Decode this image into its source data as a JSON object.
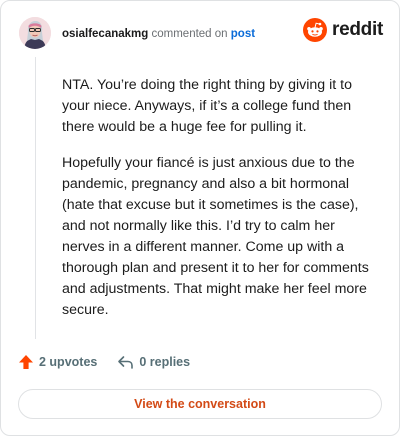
{
  "comment": {
    "author": "osialfecanakmg",
    "action_text": "commented on",
    "target_link": "post",
    "paragraphs": [
      "NTA. You’re doing the right thing by giving it to your niece. Anyways, if it’s a college fund then there would be a huge fee for pulling it.",
      "Hopefully your fiancé is just anxious due to the pandemic, pregnancy and also a bit hormonal (hate that excuse but it sometimes is the case), and not normally like this. I’d try to calm her nerves in a different manner. Come up with a thorough plan and present it to her for comments and adjustments. That might make her feel more secure."
    ]
  },
  "brand": {
    "name": "reddit",
    "icon": "reddit-logo-icon",
    "color": "#ff4500"
  },
  "actions": {
    "upvotes_label": "2 upvotes",
    "upvote_icon": "upvote-arrow-icon",
    "upvote_color": "#ff4500",
    "replies_label": "0 replies",
    "reply_icon": "reply-arrow-icon"
  },
  "cta": {
    "label": "View the conversation",
    "color": "#d34a16"
  }
}
